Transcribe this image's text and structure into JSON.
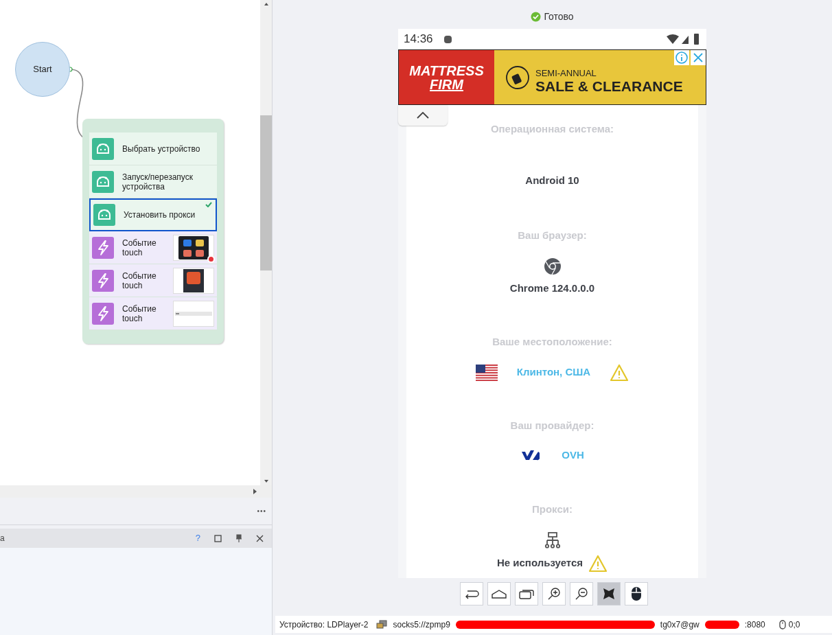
{
  "canvas": {
    "start_node": {
      "label": "Start"
    },
    "action_group": {
      "items": [
        {
          "kind": "android",
          "label": "Выбрать устройство",
          "selected": false,
          "checked": false
        },
        {
          "kind": "android",
          "label": "Запуск/перезапуск устройства",
          "selected": false,
          "checked": false
        },
        {
          "kind": "android",
          "label": "Установить прокси",
          "selected": true,
          "checked": true
        },
        {
          "kind": "touch",
          "label": "Событие touch",
          "selected": false,
          "checked": false,
          "recording": true
        },
        {
          "kind": "touch",
          "label": "Событие touch",
          "selected": false,
          "checked": false,
          "recording": false
        },
        {
          "kind": "touch",
          "label": "Событие touch",
          "selected": false,
          "checked": false,
          "recording": false
        }
      ]
    }
  },
  "more_menu": "•••",
  "bottom_panel": {
    "title": "a",
    "help": "?"
  },
  "emulator": {
    "status": "Готово",
    "phone": {
      "time": "14:36",
      "ad": {
        "brand_line_1": "MATTRESS",
        "brand_line_2": "FIRM",
        "tagline": "SEMI-ANNUAL",
        "headline": "SALE & CLEARANCE"
      },
      "sections": [
        {
          "kind": "plain",
          "heading": "Операционная система:",
          "value": "Android 10",
          "highlighted": false,
          "warning": false
        },
        {
          "kind": "browser",
          "heading": "Ваш браузер:",
          "value": "Chrome 124.0.0.0",
          "highlighted": false,
          "warning": false
        },
        {
          "kind": "location",
          "heading": "Ваше местоположение:",
          "value": "Клинтон, США",
          "highlighted": true,
          "warning": true
        },
        {
          "kind": "provider",
          "heading": "Ваш провайдер:",
          "value": "OVH",
          "highlighted": true,
          "warning": false
        },
        {
          "kind": "proxy",
          "heading": "Прокси:",
          "value": "Не используется",
          "highlighted": false,
          "warning": true
        }
      ]
    },
    "toolbar": [
      {
        "kind": "back",
        "on": false
      },
      {
        "kind": "home",
        "on": false
      },
      {
        "kind": "recent",
        "on": false
      },
      {
        "kind": "zoom-in",
        "on": false
      },
      {
        "kind": "zoom-out",
        "on": false
      },
      {
        "kind": "butterfly",
        "on": true
      },
      {
        "kind": "mouse",
        "on": false
      }
    ]
  },
  "status_bar": {
    "device": "Устройство: LDPlayer-2",
    "proxy_start": "socks5://zpmp9",
    "proxy_middle": "tg0x7@gw",
    "proxy_end": ":8080",
    "coordinates": "0;0"
  }
}
